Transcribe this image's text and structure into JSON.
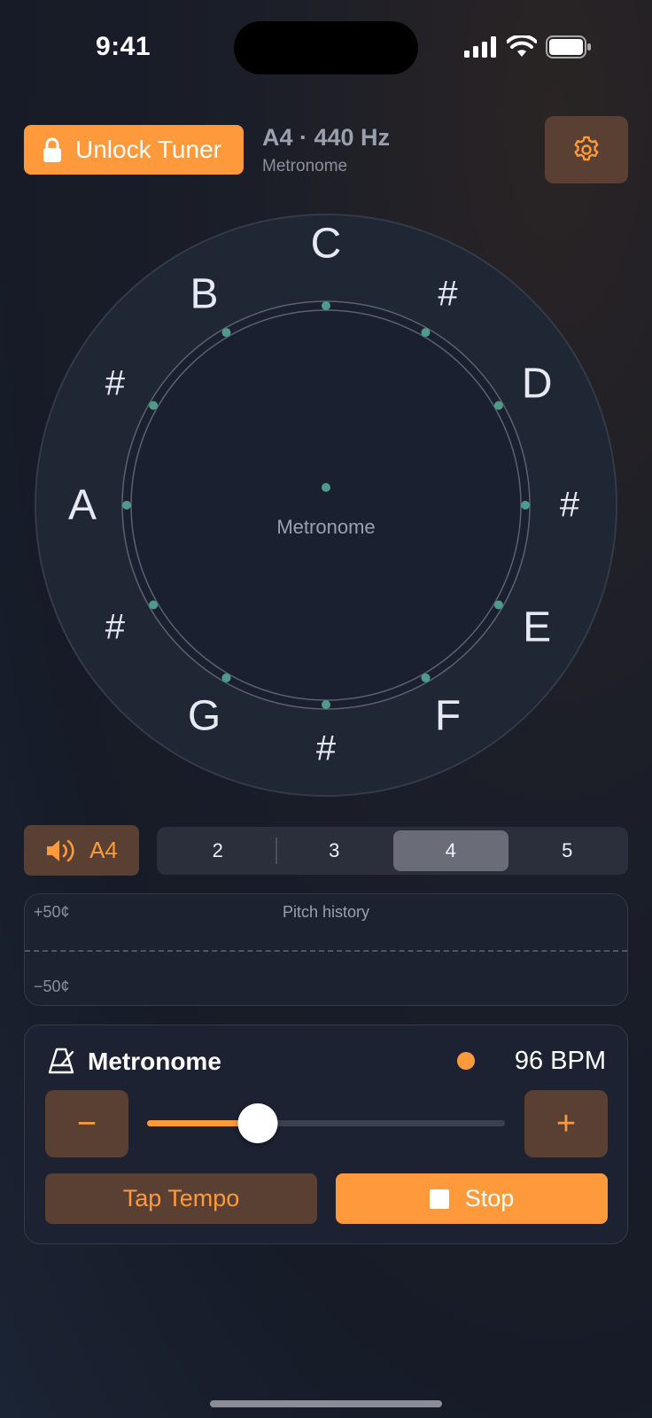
{
  "status_bar": {
    "time": "9:41"
  },
  "header": {
    "unlock_label": "Unlock Tuner",
    "title": "A4 · 440 Hz",
    "subtitle": "Metronome"
  },
  "dial": {
    "notes": [
      "C",
      "#",
      "D",
      "#",
      "E",
      "F",
      "#",
      "G",
      "#",
      "A",
      "#",
      "B"
    ],
    "center_label": "Metronome"
  },
  "tone": {
    "label": "A4"
  },
  "octaves": {
    "options": [
      "2",
      "3",
      "4",
      "5"
    ],
    "selected": "4"
  },
  "history": {
    "title": "Pitch history",
    "top_label": "+50¢",
    "bottom_label": "−50¢"
  },
  "metronome": {
    "title": "Metronome",
    "bpm_label": "96 BPM",
    "bpm": 96,
    "slider_fraction": 0.31,
    "minus": "−",
    "plus": "+",
    "tap_label": "Tap Tempo",
    "stop_label": "Stop"
  },
  "colors": {
    "accent": "#ff9a3c",
    "accent_dark": "#5a3f33",
    "tick_dot": "#4f9a8a",
    "background": "#161b27"
  },
  "icons": {
    "lock": "lock-icon",
    "settings": "gear-icon",
    "speaker": "speaker-icon",
    "metronome": "metronome-icon",
    "stop": "stop-icon"
  }
}
